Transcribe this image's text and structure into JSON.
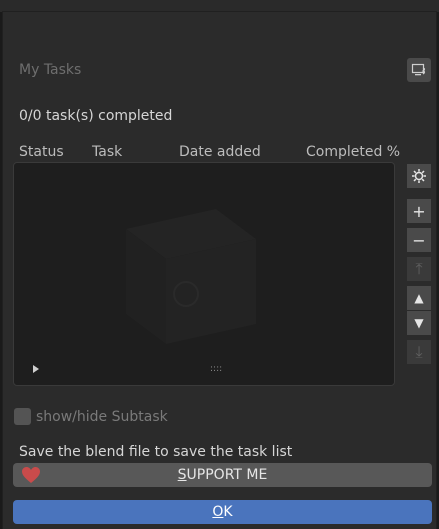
{
  "dialog": {
    "title": "My Tasks",
    "summary": "0/0 task(s) completed",
    "columns": [
      "Status",
      "Task",
      "Date added",
      "Completed %"
    ],
    "list": {
      "grip": "::::"
    },
    "side_buttons": [
      {
        "icon": "gear-icon",
        "label": "✲"
      },
      {
        "icon": "plus-icon",
        "label": "+"
      },
      {
        "icon": "minus-icon",
        "label": "−"
      },
      {
        "icon": "move-top-icon",
        "label": "⤒"
      },
      {
        "icon": "move-up-icon",
        "label": "▲"
      },
      {
        "icon": "move-down-icon",
        "label": "▼"
      },
      {
        "icon": "move-bottom-icon",
        "label": "⤓"
      }
    ],
    "subtask_toggle": "show/hide Subtask",
    "hint": "Save the blend file to save the task list",
    "support_button": {
      "prefix": "S",
      "rest": "UPPORT ME"
    },
    "ok_button": {
      "prefix": "O",
      "rest": "K"
    }
  },
  "colors": {
    "background": "#2b2b2b",
    "ok_button": "#4a74bd",
    "support_button": "#585858",
    "heart": "#c94b4b"
  }
}
